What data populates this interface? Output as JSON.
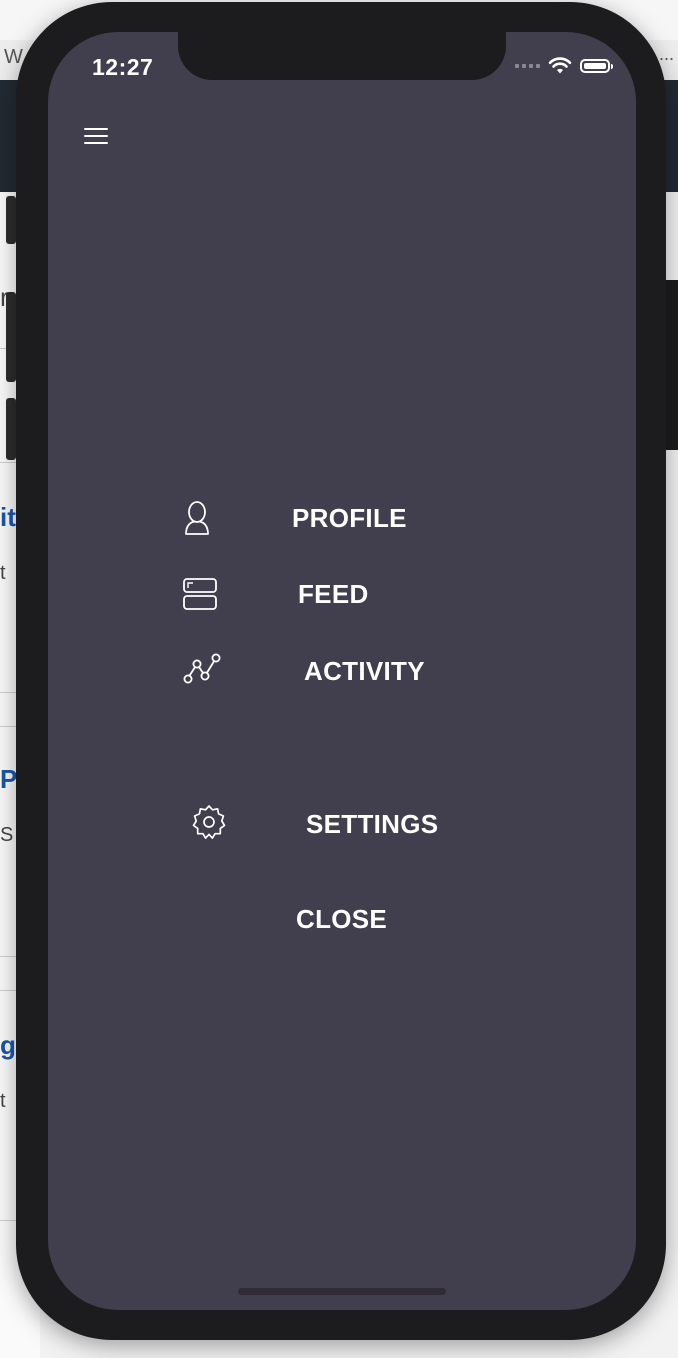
{
  "status_bar": {
    "time": "12:27"
  },
  "background_page": {
    "address_prefix": "W",
    "address_suffix": "...",
    "left_fragments": [
      "r",
      "it",
      "t",
      "Pj",
      "S",
      "ge",
      "t"
    ]
  },
  "menu": {
    "items": [
      {
        "label": "PROFILE",
        "icon": "person-icon"
      },
      {
        "label": "FEED",
        "icon": "feed-icon"
      },
      {
        "label": "ACTIVITY",
        "icon": "activity-graph-icon"
      },
      {
        "label": "SETTINGS",
        "icon": "gear-icon"
      }
    ],
    "close_label": "CLOSE"
  },
  "colors": {
    "screen_background": "#413e4d",
    "phone_frame": "#1c1c1e",
    "text": "#ffffff"
  }
}
